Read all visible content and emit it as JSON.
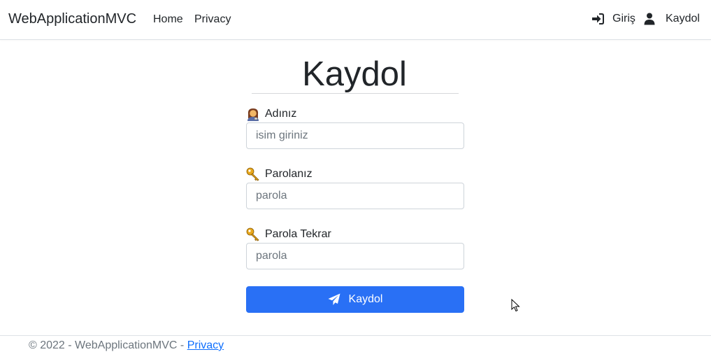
{
  "navbar": {
    "brand": "WebApplicationMVC",
    "links": [
      {
        "label": "Home"
      },
      {
        "label": "Privacy"
      }
    ],
    "right": {
      "login_label": "Giriş",
      "login_icon": "sign-in-icon",
      "register_label": "Kaydol",
      "register_icon": "user-icon"
    }
  },
  "form": {
    "title": "Kaydol",
    "fields": [
      {
        "label": "Adınız",
        "icon": "person-emoji-icon",
        "placeholder": "isim giriniz",
        "value": ""
      },
      {
        "label": "Parolanız",
        "icon": "key-emoji-icon",
        "placeholder": "parola",
        "value": ""
      },
      {
        "label": "Parola Tekrar",
        "icon": "key-emoji-icon",
        "placeholder": "parola",
        "value": ""
      }
    ],
    "submit": {
      "label": "Kaydol",
      "icon": "paper-plane-icon"
    }
  },
  "footer": {
    "copyright": "© 2022 - WebApplicationMVC - ",
    "privacy_link": "Privacy"
  },
  "colors": {
    "primary": "#2970f5",
    "link": "#0d6efd",
    "muted": "#6c757d"
  }
}
